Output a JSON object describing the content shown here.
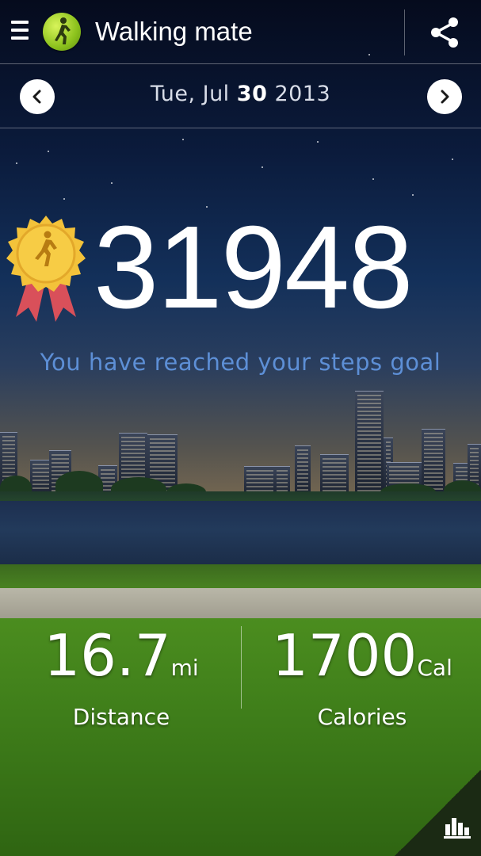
{
  "app": {
    "title": "Walking mate"
  },
  "date_nav": {
    "prefix": "Tue, Jul ",
    "day": "30",
    "suffix": " 2013"
  },
  "steps": {
    "count": "31948",
    "goal_message": "You have reached your steps goal"
  },
  "stats": {
    "distance": {
      "value": "16.7",
      "unit": "mi",
      "label": "Distance"
    },
    "calories": {
      "value": "1700",
      "unit": "Cal",
      "label": "Calories"
    }
  },
  "icons": {
    "menu": "menu-icon",
    "app": "walking-person-icon",
    "share": "share-icon",
    "prev": "chevron-left-icon",
    "next": "chevron-right-icon",
    "medal": "medal-icon",
    "chart": "bar-chart-icon"
  },
  "colors": {
    "goal_text": "#5d8fd6",
    "text": "#ffffff"
  }
}
